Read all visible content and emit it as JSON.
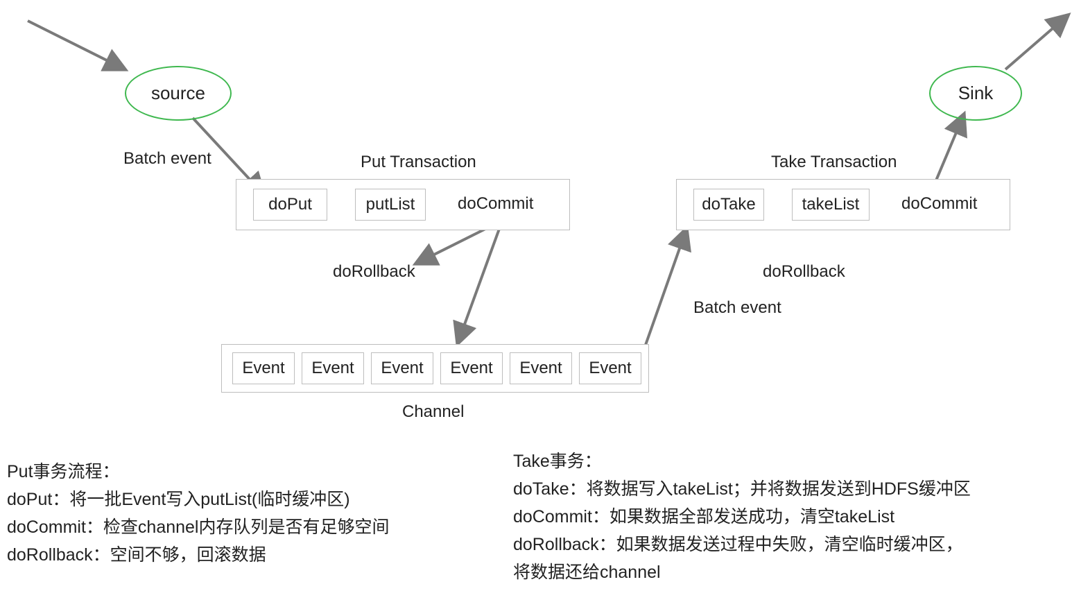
{
  "nodes": {
    "source": "source",
    "sink": "Sink"
  },
  "labels": {
    "batch_event_left": "Batch event",
    "batch_event_right": "Batch event",
    "put_title": "Put Transaction",
    "take_title": "Take Transaction",
    "do_rollback_left": "doRollback",
    "do_rollback_right": "doRollback",
    "do_commit_left": "doCommit",
    "do_commit_right": "doCommit",
    "channel": "Channel"
  },
  "put_box": {
    "doPut": "doPut",
    "putList": "putList"
  },
  "take_box": {
    "doTake": "doTake",
    "takeList": "takeList"
  },
  "channel_events": [
    "Event",
    "Event",
    "Event",
    "Event",
    "Event",
    "Event"
  ],
  "desc_put": "Put事务流程：\ndoPut：将一批Event写入putList(临时缓冲区)\ndoCommit：检查channel内存队列是否有足够空间\ndoRollback：空间不够，回滚数据",
  "desc_take": "Take事务：\ndoTake：将数据写入takeList；并将数据发送到HDFS缓冲区\ndoCommit：如果数据全部发送成功，清空takeList\ndoRollback：如果数据发送过程中失败，清空临时缓冲区，\n将数据还给channel"
}
